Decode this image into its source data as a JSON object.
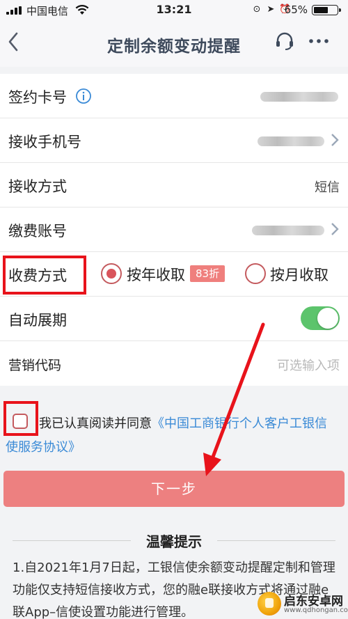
{
  "status_bar": {
    "carrier": "中国电信",
    "time": "13:21",
    "battery_percent": "65%",
    "battery_level": 0.65
  },
  "nav": {
    "title": "定制余额变动提醒",
    "icons": [
      "back-icon",
      "headset-icon",
      "more-icon"
    ]
  },
  "form": {
    "card_label": "签约卡号",
    "phone_label": "接收手机号",
    "method_label": "接收方式",
    "method_value": "短信",
    "account_label": "缴费账号",
    "fee_label": "收费方式",
    "fee_option_year": "按年收取",
    "fee_discount": "83折",
    "fee_option_month": "按月收取",
    "fee_selected": "year",
    "renew_label": "自动展期",
    "renew_on": true,
    "promo_label": "营销代码",
    "promo_placeholder": "可选输入项"
  },
  "agreement": {
    "text": "我已认真阅读并同意",
    "link_part1": "《中国工商银行个人客户工银信",
    "link_part2": "使服务协议》",
    "checked": false
  },
  "next_button": "下一步",
  "tips": {
    "title": "温馨提示",
    "body": "1.自2021年1月7日起，工银信使余额变动提醒定制和管理功能仅支持短信接收方式，您的融e联接收方式将通过融e联App–信使设置功能进行管理。"
  },
  "watermark": {
    "name": "启东安卓网",
    "url": "www.qdhongan.com"
  },
  "colors": {
    "annotation_red": "#e8131b",
    "button": "#ed8080",
    "toggle_on": "#5cc46c",
    "link": "#3a8ad6"
  }
}
